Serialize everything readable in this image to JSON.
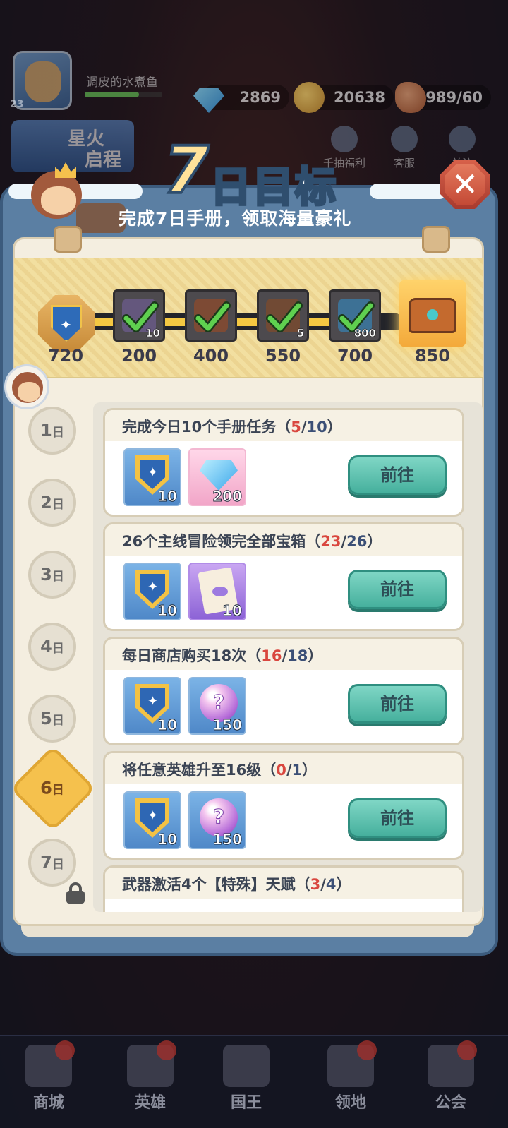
{
  "hud": {
    "player_name": "调皮的水煮鱼",
    "level": "23",
    "xp_fraction": 0.7,
    "gems": "2869",
    "coins": "20638",
    "stamina": "989/60",
    "banner_line1": "星火",
    "banner_line2": "启程",
    "btn_draw": "千抽福利",
    "btn_service": "客服",
    "btn_follow": "关注"
  },
  "title": {
    "number": "7",
    "text": "日目标",
    "subtitle": "完成7日手册，领取海量豪礼",
    "close": "✕"
  },
  "milestones": {
    "progress_value": 720,
    "current_label": "720",
    "items": [
      {
        "label": "200",
        "qty": "10",
        "claimed": true,
        "icon": "book-icon"
      },
      {
        "label": "400",
        "qty": "",
        "claimed": true,
        "icon": "cookie-icon"
      },
      {
        "label": "550",
        "qty": "5",
        "claimed": true,
        "icon": "hammer-icon"
      },
      {
        "label": "700",
        "qty": "800",
        "claimed": true,
        "icon": "gem-icon"
      },
      {
        "label": "850",
        "qty": "",
        "claimed": false,
        "icon": "chest-icon"
      }
    ]
  },
  "days": [
    "1",
    "2",
    "3",
    "4",
    "5",
    "6",
    "7"
  ],
  "day_suffix": "日",
  "active_day": "6",
  "tasks": [
    {
      "title": "完成今日10个手册任务",
      "current": "5",
      "total": "10",
      "rewards": [
        {
          "type": "shield",
          "qty": "10"
        },
        {
          "type": "gem",
          "qty": "200"
        }
      ],
      "button": "前往"
    },
    {
      "title": "26个主线冒险领完全部宝箱",
      "current": "23",
      "total": "26",
      "rewards": [
        {
          "type": "shield",
          "qty": "10"
        },
        {
          "type": "scroll",
          "qty": "10"
        }
      ],
      "button": "前往"
    },
    {
      "title": "每日商店购买18次",
      "current": "16",
      "total": "18",
      "rewards": [
        {
          "type": "shield",
          "qty": "10"
        },
        {
          "type": "orb",
          "qty": "150"
        }
      ],
      "button": "前往"
    },
    {
      "title": "将任意英雄升至16级",
      "current": "0",
      "total": "1",
      "rewards": [
        {
          "type": "shield",
          "qty": "10"
        },
        {
          "type": "orb",
          "qty": "150"
        }
      ],
      "button": "前往"
    },
    {
      "title": "武器激活4个【特殊】天赋",
      "current": "3",
      "total": "4",
      "rewards": [],
      "button": ""
    }
  ],
  "bottom_nav": [
    "商城",
    "英雄",
    "国王",
    "领地",
    "公会"
  ],
  "colors": {
    "accent": "#f5c842",
    "panel": "#5b7fa3",
    "go_button": "#46b09d",
    "current_progress": "#d9473f"
  }
}
